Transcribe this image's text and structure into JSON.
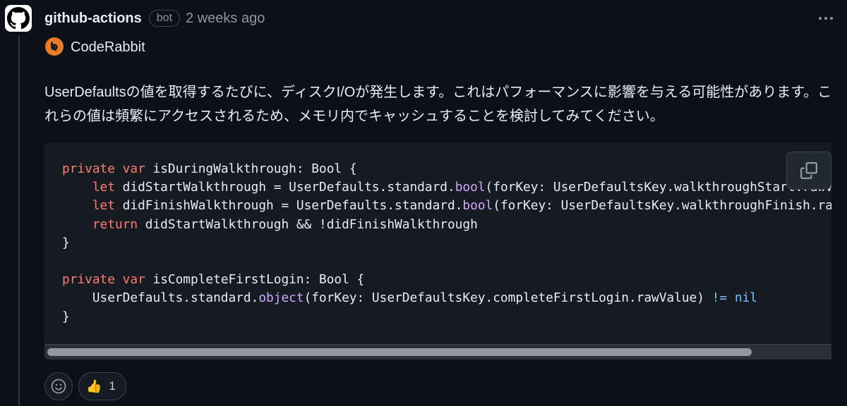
{
  "comment": {
    "author": "github-actions",
    "badge": "bot",
    "timestamp": "2 weeks ago",
    "reviewer": "CodeRabbit",
    "message": "UserDefaultsの値を取得するたびに、ディスクI/Oが発生します。これはパフォーマンスに影響を与える可能性があります。これらの値は頻繁にアクセスされるため、メモリ内でキャッシュすることを検討してみてください。"
  },
  "code": {
    "language": "swift",
    "lines": [
      "private var isDuringWalkthrough: Bool {",
      "    let didStartWalkthrough = UserDefaults.standard.bool(forKey: UserDefaultsKey.walkthroughStart.rawValue)",
      "    let didFinishWalkthrough = UserDefaults.standard.bool(forKey: UserDefaultsKey.walkthroughFinish.rawValue)",
      "    return didStartWalkthrough && !didFinishWalkthrough",
      "}",
      "",
      "private var isCompleteFirstLogin: Bool {",
      "    UserDefaults.standard.object(forKey: UserDefaultsKey.completeFirstLogin.rawValue) != nil",
      "}"
    ],
    "scroll_fraction_visible": 0.9
  },
  "reactions": [
    {
      "emoji": "👍",
      "count": "1"
    }
  ],
  "icons": {
    "avatar": "github-icon",
    "more": "kebab-horizontal-icon",
    "reviewer": "coderabbit-icon",
    "copy": "copy-icon",
    "add_reaction": "smiley-icon"
  },
  "colors": {
    "background": "#0d1117",
    "code_background": "#161b22",
    "keyword": "#ff7b72",
    "function": "#d2a8ff",
    "type": "#79c0ff",
    "muted": "#8d96a0"
  }
}
